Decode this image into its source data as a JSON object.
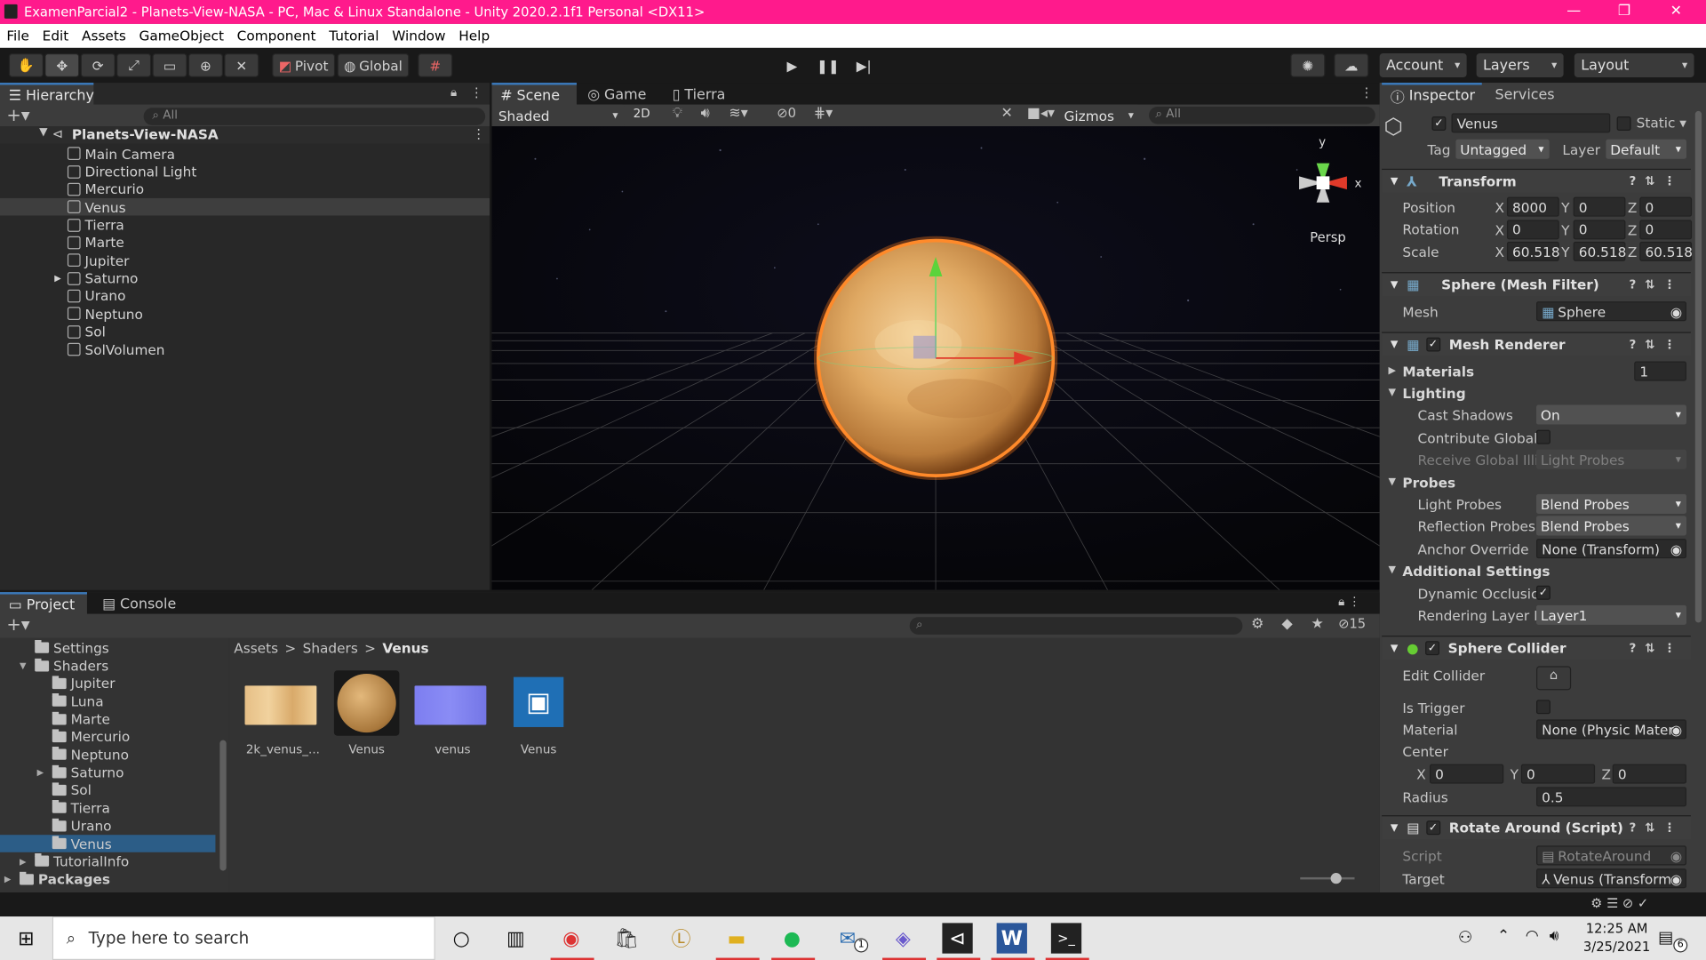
{
  "window": {
    "title": "ExamenParcial2 - Planets-View-NASA - PC, Mac & Linux Standalone - Unity 2020.2.1f1 Personal <DX11>",
    "controls": [
      "—",
      "❐",
      "✕"
    ]
  },
  "menu": [
    "File",
    "Edit",
    "Assets",
    "GameObject",
    "Component",
    "Tutorial",
    "Window",
    "Help"
  ],
  "toolbar": {
    "pivot": "Pivot",
    "global": "Global",
    "account": "Account",
    "layers": "Layers",
    "layout": "Layout"
  },
  "hierarchy": {
    "tab": "Hierarchy",
    "search_placeholder": "All",
    "scene": "Planets-View-NASA",
    "items": [
      "Main Camera",
      "Directional Light",
      "Mercurio",
      "Venus",
      "Tierra",
      "Marte",
      "Jupiter",
      "Saturno",
      "Urano",
      "Neptuno",
      "Sol",
      "SolVolumen"
    ],
    "selected": "Venus"
  },
  "scene": {
    "tabs": [
      "Scene",
      "Game",
      "Tierra"
    ],
    "shading": "Shaded",
    "mode2d": "2D",
    "hidden_count": "0",
    "gizmos": "Gizmos",
    "search_placeholder": "All",
    "persp": "Persp",
    "axis_y": "y",
    "axis_x": "x"
  },
  "inspector": {
    "tabs": [
      "Inspector",
      "Services"
    ],
    "object_name": "Venus",
    "static": "Static",
    "tag_label": "Tag",
    "tag_value": "Untagged",
    "layer_label": "Layer",
    "layer_value": "Default",
    "transform": {
      "title": "Transform",
      "position_label": "Position",
      "rotation_label": "Rotation",
      "scale_label": "Scale",
      "position": [
        "8000",
        "0",
        "0"
      ],
      "rotation": [
        "0",
        "0",
        "0"
      ],
      "scale": [
        "60.518",
        "60.518",
        "60.518"
      ]
    },
    "mesh_filter": {
      "title": "Sphere (Mesh Filter)",
      "mesh_label": "Mesh",
      "mesh_value": "Sphere"
    },
    "mesh_renderer": {
      "title": "Mesh Renderer",
      "materials_label": "Materials",
      "materials_count": "1",
      "lighting_label": "Lighting",
      "cast_shadows_label": "Cast Shadows",
      "cast_shadows_value": "On",
      "contribute_gi_label": "Contribute Global",
      "receive_gi_label": "Receive Global Illi",
      "receive_gi_value": "Light Probes",
      "probes_label": "Probes",
      "light_probes_label": "Light Probes",
      "light_probes_value": "Blend Probes",
      "reflection_probes_label": "Reflection Probes",
      "reflection_probes_value": "Blend Probes",
      "anchor_label": "Anchor Override",
      "anchor_value": "None (Transform)",
      "additional_label": "Additional Settings",
      "dynamic_occlusion_label": "Dynamic Occlusic",
      "rendering_layer_label": "Rendering Layer M",
      "rendering_layer_value": "Layer1"
    },
    "sphere_collider": {
      "title": "Sphere Collider",
      "edit_label": "Edit Collider",
      "trigger_label": "Is Trigger",
      "material_label": "Material",
      "material_value": "None (Physic Mater",
      "center_label": "Center",
      "center": [
        "0",
        "0",
        "0"
      ],
      "radius_label": "Radius",
      "radius_value": "0.5"
    },
    "rotate_around": {
      "title": "Rotate Around (Script)",
      "script_label": "Script",
      "script_value": "RotateAround",
      "target_label": "Target",
      "target_value": "Venus (Transform"
    }
  },
  "project": {
    "tabs": [
      "Project",
      "Console"
    ],
    "hidden_count": "15",
    "breadcrumb": [
      "Assets",
      "Shaders",
      "Venus"
    ],
    "tree": [
      {
        "label": "Settings",
        "depth": 1,
        "arrow": ""
      },
      {
        "label": "Shaders",
        "depth": 1,
        "arrow": "▼"
      },
      {
        "label": "Jupiter",
        "depth": 2,
        "arrow": ""
      },
      {
        "label": "Luna",
        "depth": 2,
        "arrow": ""
      },
      {
        "label": "Marte",
        "depth": 2,
        "arrow": ""
      },
      {
        "label": "Mercurio",
        "depth": 2,
        "arrow": ""
      },
      {
        "label": "Neptuno",
        "depth": 2,
        "arrow": ""
      },
      {
        "label": "Saturno",
        "depth": 2,
        "arrow": "▶"
      },
      {
        "label": "Sol",
        "depth": 2,
        "arrow": ""
      },
      {
        "label": "Tierra",
        "depth": 2,
        "arrow": ""
      },
      {
        "label": "Urano",
        "depth": 2,
        "arrow": ""
      },
      {
        "label": "Venus",
        "depth": 2,
        "arrow": ""
      },
      {
        "label": "TutorialInfo",
        "depth": 1,
        "arrow": "▶"
      },
      {
        "label": "Packages",
        "depth": 0,
        "arrow": "▶"
      }
    ],
    "selected": "Venus",
    "assets": [
      "2k_venus_...",
      "Venus",
      "venus",
      "Venus"
    ]
  },
  "taskbar": {
    "search_placeholder": "Type here to search",
    "time": "12:25 AM",
    "date": "3/25/2021",
    "notifications": "6",
    "mail_badge": "1"
  }
}
